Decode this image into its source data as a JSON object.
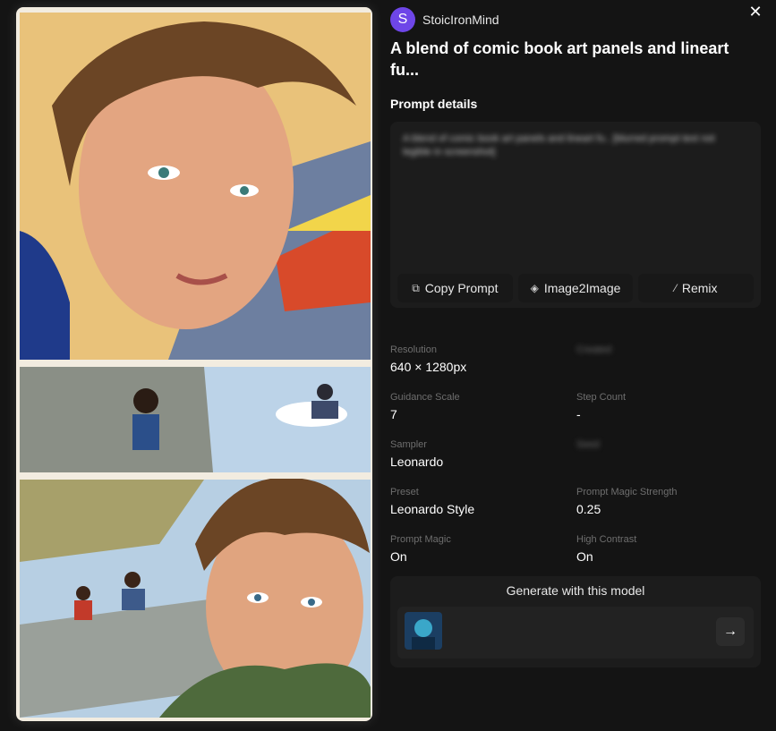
{
  "header": {
    "author_initial": "S",
    "author_name": "StoicIronMind",
    "close_icon": "close-icon",
    "title": "A blend of comic book art panels and lineart fu..."
  },
  "prompt": {
    "section_label": "Prompt details",
    "text": "A blend of comic book art panels and lineart fu.. [blurred prompt text not legible in screenshot]",
    "actions": {
      "copy_label": "Copy Prompt",
      "copy_icon": "copy-icon",
      "img2img_label": "Image2Image",
      "img2img_icon": "layers-icon",
      "remix_label": "Remix",
      "remix_icon": "wand-icon"
    }
  },
  "details": {
    "resolution": {
      "label": "Resolution",
      "value": "640 × 1280px"
    },
    "created": {
      "label": "Created",
      "value": ""
    },
    "guidance": {
      "label": "Guidance Scale",
      "value": "7"
    },
    "steps": {
      "label": "Step Count",
      "value": "-"
    },
    "sampler": {
      "label": "Sampler",
      "value": "Leonardo"
    },
    "seed": {
      "label": "Seed",
      "value": ""
    },
    "preset": {
      "label": "Preset",
      "value": "Leonardo Style"
    },
    "magic_strength": {
      "label": "Prompt Magic Strength",
      "value": "0.25"
    },
    "prompt_magic": {
      "label": "Prompt Magic",
      "value": "On"
    },
    "high_contrast": {
      "label": "High Contrast",
      "value": "On"
    }
  },
  "generate": {
    "title": "Generate with this model",
    "model_kicker": "",
    "model_name": "",
    "arrow_icon": "arrow-right-icon"
  },
  "colors": {
    "background": "#141414",
    "panel": "#1c1c1c",
    "avatar": "#6e46e8"
  }
}
